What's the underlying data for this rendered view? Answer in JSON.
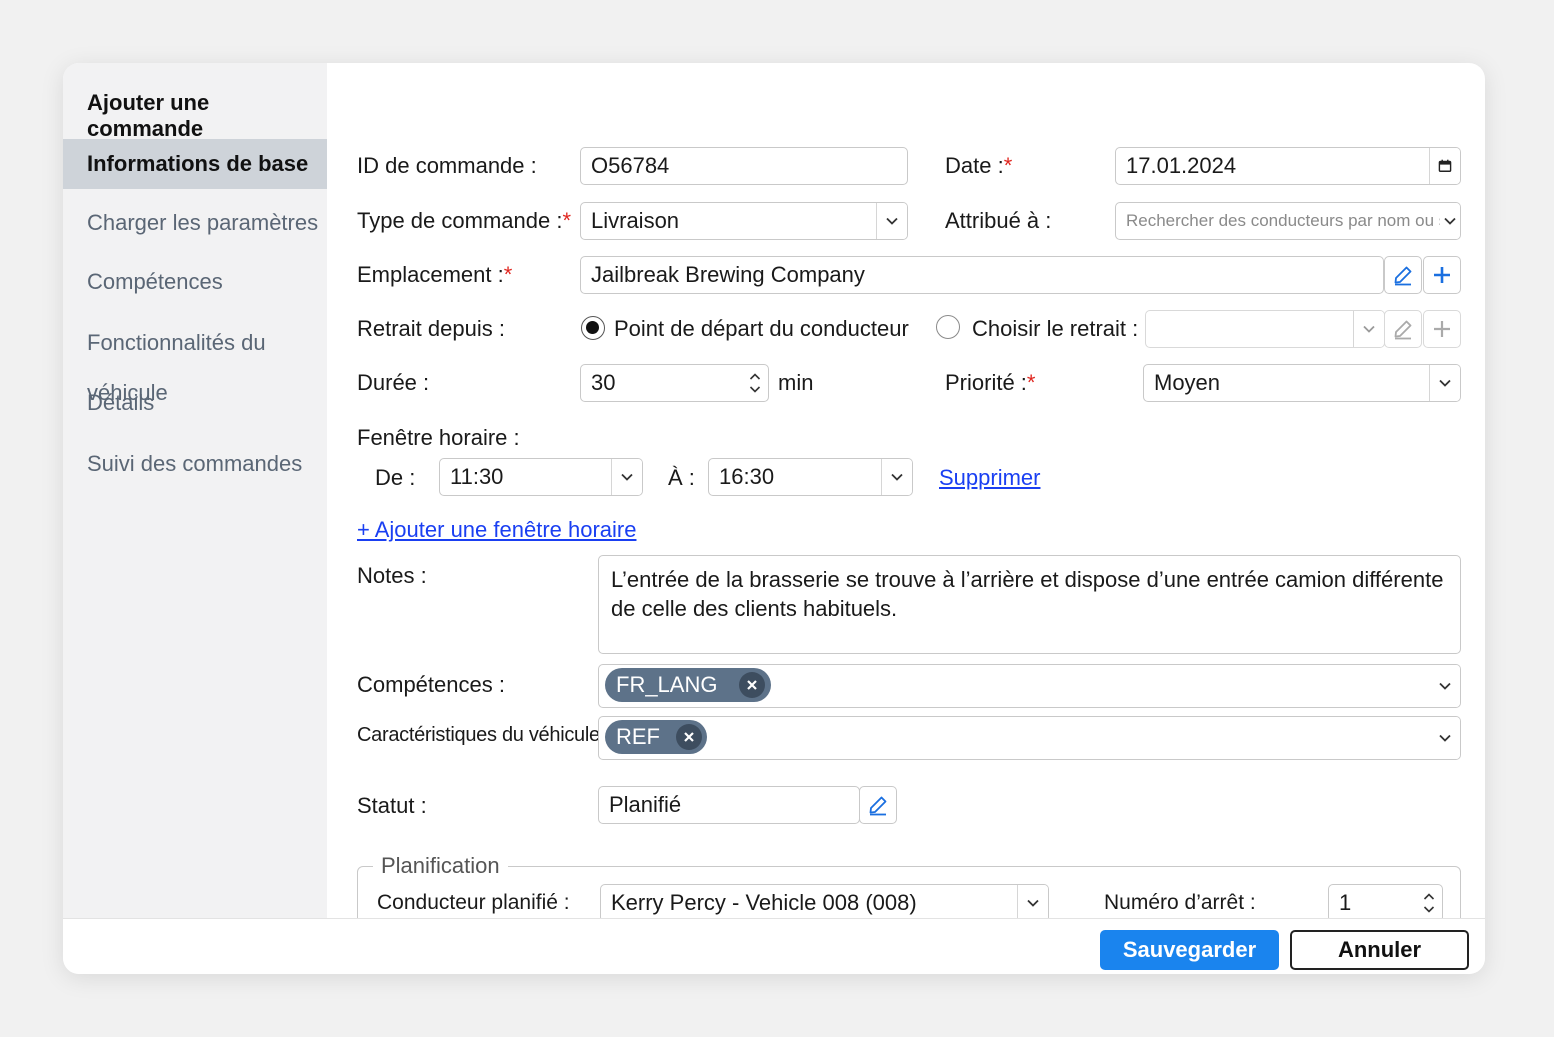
{
  "dialog": {
    "title": "Ajouter une commande"
  },
  "sidebar": {
    "items": [
      {
        "label": "Informations de base",
        "active": true
      },
      {
        "label": "Charger les paramètres"
      },
      {
        "label": "Compétences"
      },
      {
        "label": "Fonctionnalités du véhicule"
      },
      {
        "label": "Détails"
      },
      {
        "label": "Suivi des commandes"
      }
    ]
  },
  "form": {
    "order_id": {
      "label": "ID de commande :",
      "value": "O56784"
    },
    "date": {
      "label": "Date :",
      "required_mark": "*",
      "value": "17.01.2024",
      "icon": "calendar-icon"
    },
    "order_type": {
      "label": "Type de commande :",
      "required_mark": "*",
      "value": "Livraison"
    },
    "assigned_to": {
      "label": "Attribué à :",
      "placeholder": "Rechercher des conducteurs par nom ou se"
    },
    "location": {
      "label": "Emplacement :",
      "required_mark": "*",
      "value": "Jailbreak Brewing Company"
    },
    "pickup": {
      "label": "Retrait depuis :",
      "option_driver": "Point de départ du conducteur",
      "option_choose": "Choisir le retrait :",
      "selected": "driver"
    },
    "duration": {
      "label": "Durée :",
      "value": "30",
      "unit": "min"
    },
    "priority": {
      "label": "Priorité :",
      "required_mark": "*",
      "value": "Moyen"
    },
    "time_window": {
      "label": "Fenêtre horaire :",
      "from_label": "De :",
      "from_value": "11:30",
      "to_label": "À :",
      "to_value": "16:30",
      "delete_link": "Supprimer",
      "add_link": "+ Ajouter une fenêtre horaire"
    },
    "notes": {
      "label": "Notes :",
      "value": "L’entrée de la brasserie se trouve à l’arrière et dispose d’une entrée camion différente de celle des clients habituels."
    },
    "skills": {
      "label": "Compétences :",
      "chips": [
        "FR_LANG"
      ]
    },
    "vehicle_features": {
      "label": "Caractéristiques du véhicule :",
      "chips": [
        "REF"
      ]
    },
    "status": {
      "label": "Statut :",
      "value": "Planifié"
    },
    "planning": {
      "legend": "Planification",
      "driver_label": "Conducteur planifié :",
      "driver_value": "Kerry Percy - Vehicle 008 (008)",
      "stop_label": "Numéro d’arrêt :",
      "stop_value": "1"
    }
  },
  "footer": {
    "save_label": "Sauvegarder",
    "cancel_label": "Annuler"
  },
  "colors": {
    "primary": "#1a84ee",
    "link": "#1a3ff2",
    "required": "#e0261f",
    "chip": "#5d7289",
    "sidebar_active": "#ced3d9"
  }
}
